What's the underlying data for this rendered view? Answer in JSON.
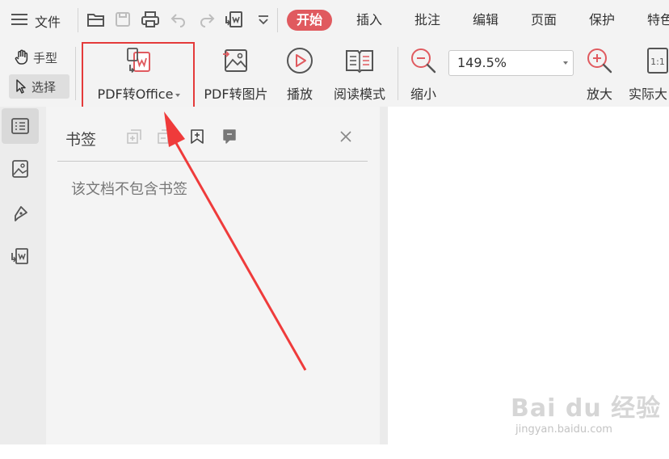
{
  "menu": {
    "file_label": "文件",
    "tabs": [
      {
        "label": "开始",
        "active": true
      },
      {
        "label": "插入"
      },
      {
        "label": "批注"
      },
      {
        "label": "编辑"
      },
      {
        "label": "页面"
      },
      {
        "label": "保护"
      },
      {
        "label": "特色"
      }
    ],
    "quick_access_icons": [
      "open-folder-icon",
      "save-icon",
      "print-icon",
      "undo-icon",
      "redo-icon",
      "convert-icon",
      "more-icon"
    ]
  },
  "ribbon": {
    "hand_tool": "手型",
    "select_tool": "选择",
    "pdf_to_office": "PDF转Office",
    "pdf_to_image": "PDF转图片",
    "play": "播放",
    "read_mode": "阅读模式",
    "zoom_out": "缩小",
    "zoom_value": "149.5%",
    "zoom_in": "放大",
    "actual_size": "实际大",
    "actual_size_icon_text": "1:1"
  },
  "sidebar": {
    "items": [
      "bookmark-list-icon",
      "image-icon",
      "pen-icon",
      "convert-icon"
    ]
  },
  "bookmark_panel": {
    "title": "书签",
    "empty_message": "该文档不包含书签"
  },
  "watermark": {
    "text": "Bai du 经验",
    "url": "jingyan.baidu.com"
  },
  "colors": {
    "accent": "#e05a5f",
    "highlight": "#e43a3a",
    "toolbar_bg": "#f3f3f3",
    "panel_bg": "#f4f4f4"
  }
}
